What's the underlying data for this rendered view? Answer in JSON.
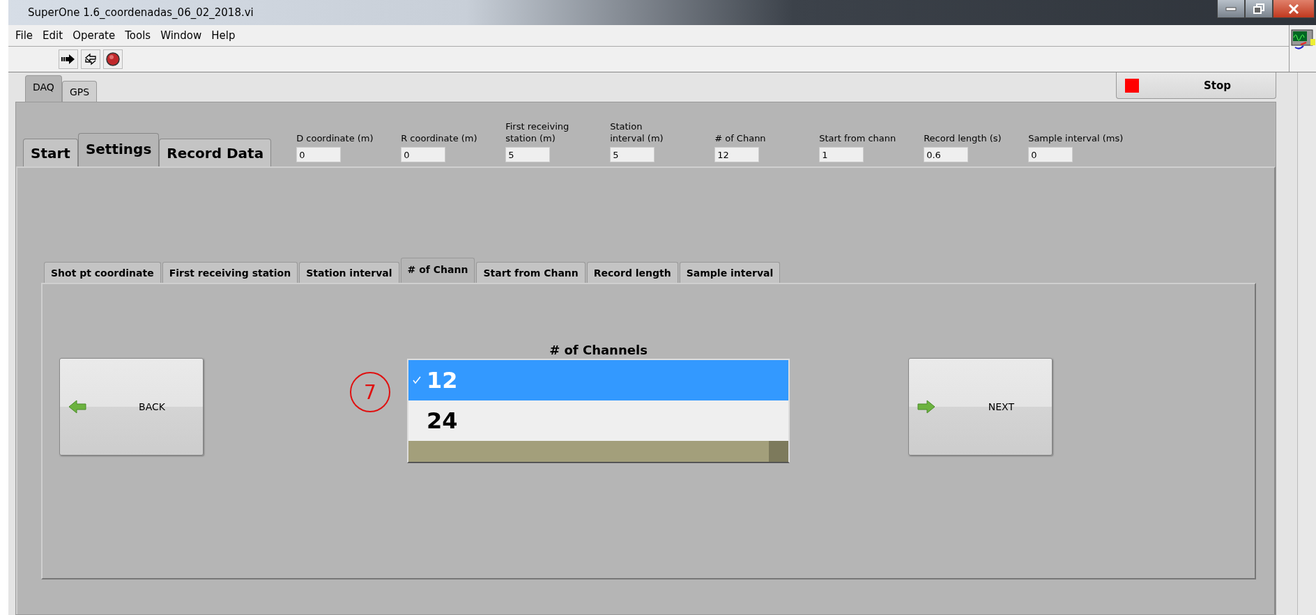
{
  "window": {
    "title": "SuperOne 1.6_coordenadas_06_02_2018.vi"
  },
  "menu": [
    "File",
    "Edit",
    "Operate",
    "Tools",
    "Window",
    "Help"
  ],
  "top_tabs": [
    {
      "label": "DAQ",
      "selected": true
    },
    {
      "label": "GPS",
      "selected": false
    }
  ],
  "stop_button": {
    "label": "Stop"
  },
  "section_tabs": [
    {
      "label": "Start",
      "selected": false
    },
    {
      "label": "Settings",
      "selected": true
    },
    {
      "label": "Record Data",
      "selected": false
    }
  ],
  "fields": [
    {
      "label": "D coordinate (m)",
      "value": "0"
    },
    {
      "label": "R coordinate (m)",
      "value": "0"
    },
    {
      "label": "First receiving\nstation (m)",
      "value": "5"
    },
    {
      "label": "Station\ninterval (m)",
      "value": "5"
    },
    {
      "label": "# of Chann",
      "value": "12"
    },
    {
      "label": "Start from chann",
      "value": "1"
    },
    {
      "label": "Record length (s)",
      "value": "0.6"
    },
    {
      "label": "Sample interval (ms)",
      "value": "0"
    }
  ],
  "setting_tabs": [
    {
      "label": "Shot pt coordinate",
      "selected": false
    },
    {
      "label": "First receiving station",
      "selected": false
    },
    {
      "label": "Station interval",
      "selected": false
    },
    {
      "label": "# of Chann",
      "selected": true
    },
    {
      "label": "Start from Chann",
      "selected": false
    },
    {
      "label": "Record length",
      "selected": false
    },
    {
      "label": "Sample interval",
      "selected": false
    }
  ],
  "back_button": {
    "label": "BACK"
  },
  "channels_list": {
    "label": "# of Channels",
    "items": [
      {
        "label": "12",
        "selected": true
      },
      {
        "label": "24",
        "selected": false
      }
    ]
  },
  "next_button": {
    "label": "NEXT"
  },
  "annotation": {
    "label": "7"
  }
}
